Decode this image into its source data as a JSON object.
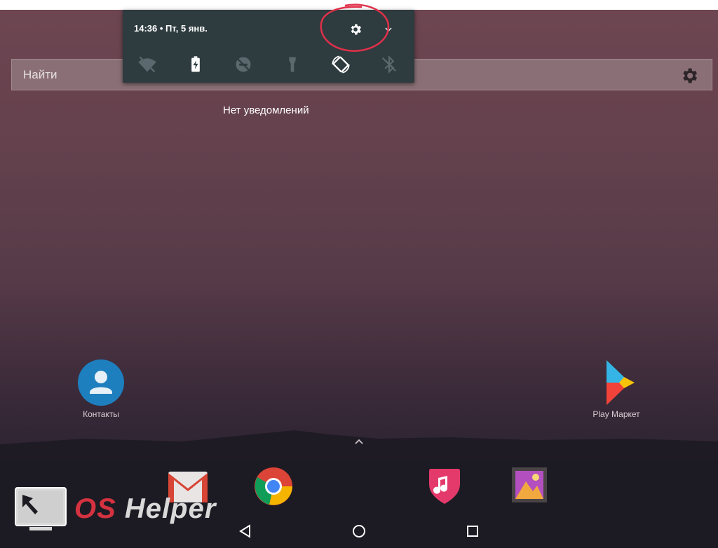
{
  "status": {
    "time": "14:36",
    "date": "Пт, 5 янв."
  },
  "shade": {
    "settings_icon": "gear-icon",
    "expand_icon": "chevron-down-icon",
    "quick_settings": [
      {
        "name": "wifi-off-icon",
        "label": "Wi-Fi"
      },
      {
        "name": "battery-saver-icon",
        "label": "Battery"
      },
      {
        "name": "do-not-disturb-icon",
        "label": "Do not disturb"
      },
      {
        "name": "flashlight-icon",
        "label": "Flashlight"
      },
      {
        "name": "auto-rotate-icon",
        "label": "Auto-rotate"
      },
      {
        "name": "bluetooth-off-icon",
        "label": "Bluetooth"
      }
    ]
  },
  "search": {
    "placeholder": "Найти"
  },
  "notifications": {
    "empty_text": "Нет уведомлений"
  },
  "apps": {
    "contacts_label": "Контакты",
    "play_label": "Play Маркет"
  },
  "dock": [
    "gmail-icon",
    "chrome-icon",
    "music-icon",
    "gallery-icon"
  ],
  "watermark": {
    "os": "OS",
    "helper": "Helper"
  },
  "colors": {
    "shade_bg": "#2e3b3f",
    "annotation": "#e0304a",
    "watermark_red": "#d43240",
    "contacts_blue": "#1e7fbf"
  }
}
